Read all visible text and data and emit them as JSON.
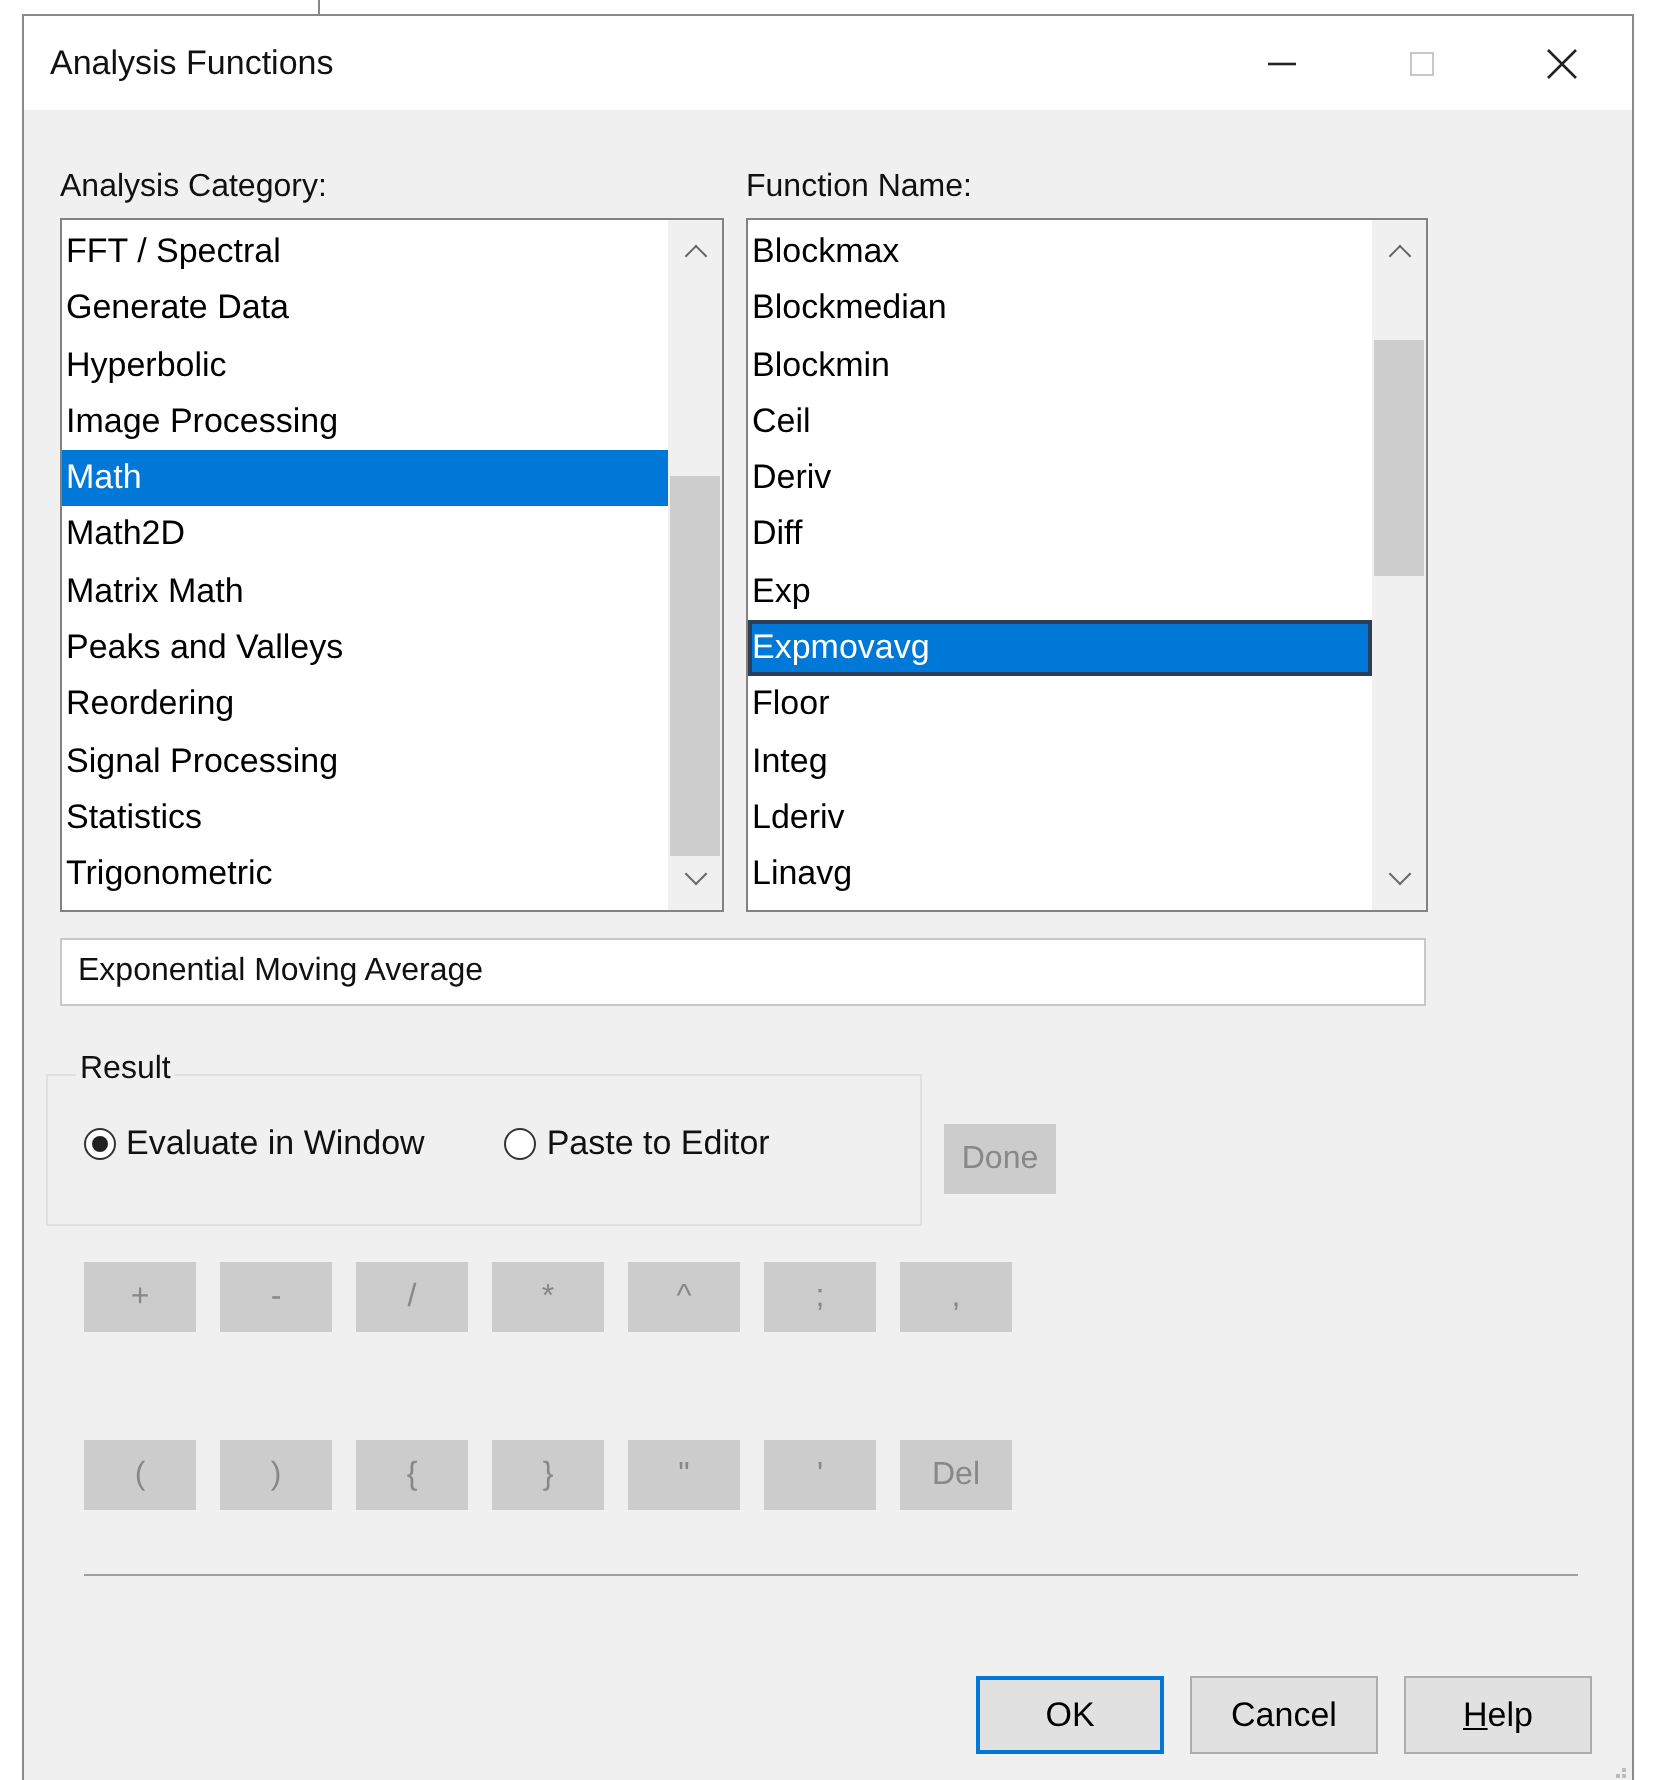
{
  "window": {
    "title": "Analysis Functions",
    "maximize_disabled": true
  },
  "category_list": {
    "label": "Analysis Category:",
    "items": [
      {
        "text": "FFT / Spectral",
        "selected": false
      },
      {
        "text": "Generate Data",
        "selected": false
      },
      {
        "text": "Hyperbolic",
        "selected": false
      },
      {
        "text": "Image Processing",
        "selected": false
      },
      {
        "text": "Math",
        "selected": true
      },
      {
        "text": "Math2D",
        "selected": false
      },
      {
        "text": "Matrix Math",
        "selected": false
      },
      {
        "text": "Peaks and Valleys",
        "selected": false
      },
      {
        "text": "Reordering",
        "selected": false
      },
      {
        "text": "Signal Processing",
        "selected": false
      },
      {
        "text": "Statistics",
        "selected": false
      },
      {
        "text": "Trigonometric",
        "selected": false
      }
    ]
  },
  "function_list": {
    "label": "Function Name:",
    "items": [
      {
        "text": "Blockmax",
        "selected": false
      },
      {
        "text": "Blockmedian",
        "selected": false
      },
      {
        "text": "Blockmin",
        "selected": false
      },
      {
        "text": "Ceil",
        "selected": false
      },
      {
        "text": "Deriv",
        "selected": false
      },
      {
        "text": "Diff",
        "selected": false
      },
      {
        "text": "Exp",
        "selected": false
      },
      {
        "text": "Expmovavg",
        "selected": true
      },
      {
        "text": "Floor",
        "selected": false
      },
      {
        "text": "Integ",
        "selected": false
      },
      {
        "text": "Lderiv",
        "selected": false
      },
      {
        "text": "Linavg",
        "selected": false
      }
    ]
  },
  "description": {
    "value": "Exponential Moving Average"
  },
  "result": {
    "label": "Result",
    "options": [
      {
        "label": "Evaluate in Window",
        "selected": true
      },
      {
        "label": "Paste to Editor",
        "selected": false
      }
    ]
  },
  "done_button": {
    "label": "Done",
    "disabled": true
  },
  "key_rows": [
    [
      {
        "label": "+",
        "disabled": true
      },
      {
        "label": "-",
        "disabled": true
      },
      {
        "label": "/",
        "disabled": true
      },
      {
        "label": "*",
        "disabled": true
      },
      {
        "label": "^",
        "disabled": true
      },
      {
        "label": ";",
        "disabled": true
      },
      {
        "label": ",",
        "disabled": true
      }
    ],
    [
      {
        "label": "(",
        "disabled": true
      },
      {
        "label": ")",
        "disabled": true
      },
      {
        "label": "{",
        "disabled": true
      },
      {
        "label": "}",
        "disabled": true
      },
      {
        "label": "\"",
        "disabled": true
      },
      {
        "label": "'",
        "disabled": true
      },
      {
        "label": "Del",
        "disabled": true
      }
    ]
  ],
  "buttons": [
    {
      "label": "OK",
      "default": true,
      "underline_first": false
    },
    {
      "label": "Cancel",
      "default": false,
      "underline_first": false
    },
    {
      "label": "Help",
      "default": false,
      "underline_first": true
    }
  ]
}
